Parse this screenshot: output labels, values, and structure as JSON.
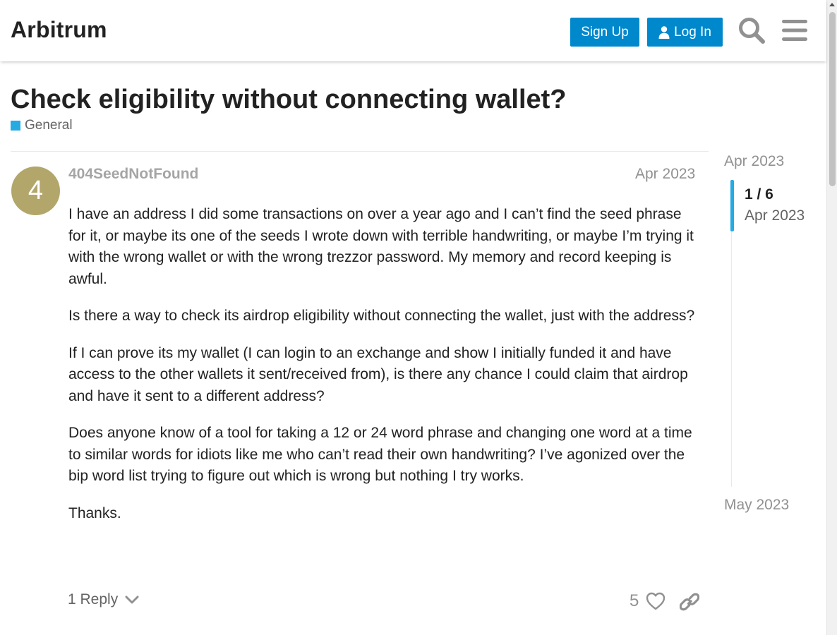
{
  "header": {
    "site_title": "Arbitrum",
    "signup_label": "Sign Up",
    "login_label": "Log In",
    "search_icon": "search-icon",
    "menu_icon": "hamburger-menu-icon"
  },
  "topic": {
    "title": "Check eligibility without connecting wallet?",
    "category": "General",
    "category_color": "#25aae1"
  },
  "post": {
    "avatar_letter": "4",
    "avatar_color": "#b3a66a",
    "username": "404SeedNotFound",
    "date": "Apr 2023",
    "paragraphs": [
      "I have an address I did some transactions on over a year ago and I can’t find the seed phrase for it, or maybe its one of the seeds I wrote down with terrible handwriting, or maybe I’m trying it with the wrong wallet or with the wrong trezzor password. My memory and record keeping is awful.",
      "Is there a way to check its airdrop eligibility without connecting the wallet, just with the address?",
      "If I can prove its my wallet (I can login to an exchange and show I initially funded it and have access to the other wallets it sent/received from), is there any chance I could claim that airdrop and have it sent to a different address?",
      "Does anyone know of a tool for taking a 12 or 24 word phrase and changing one word at a time to similar words for idiots like me who can’t read their own handwriting? I’ve agonized over the bip word list trying to figure out which is wrong but nothing I try works.",
      "Thanks."
    ],
    "replies_label": "1 Reply",
    "like_count": "5"
  },
  "timeline": {
    "start_label": "Apr 2023",
    "position": "1 / 6",
    "position_date": "Apr 2023",
    "end_label": "May 2023"
  },
  "colors": {
    "accent": "#0088cc",
    "timeline_handle": "#25aae1"
  }
}
